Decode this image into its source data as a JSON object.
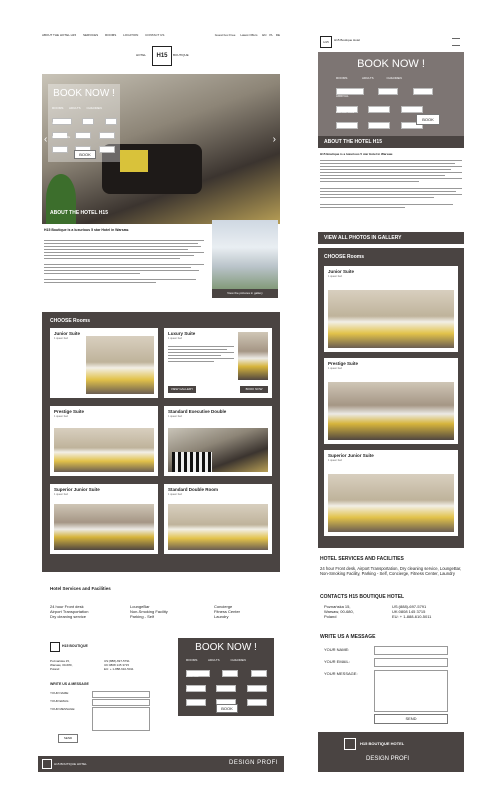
{
  "desktop": {
    "nav": [
      "ABOUT THE HOTEL H15",
      "SERVICES",
      "ROOMS",
      "LOCATION",
      "CONTACT US"
    ],
    "top_right": [
      "Guest box Free",
      "Latest Offers",
      "EN",
      "PL",
      "DE"
    ],
    "logo_left": "HOTEL",
    "logo": "H15",
    "logo_right": "BOUTIQUE",
    "booking": {
      "title": "BOOK NOW !",
      "rooms_label": "ROOMS",
      "adults_label": "ADULTS",
      "children_label": "CHILDREN",
      "arrival_label": "ARRIVAL",
      "departure_label": "DEPARTURE",
      "button": "BOOK"
    },
    "about_heading": "ABOUT THE HOTEL H15",
    "about_sub": "H15 Boutique is a luxurious 5 star Hotel in Warsaw.",
    "gallery_label": "View the pictures in gallery",
    "choose_heading": "CHOOSE Rooms",
    "rooms": [
      {
        "name": "Junior Suite",
        "sub": "1 queen bed"
      },
      {
        "name": "Luxury Suite",
        "sub": "1 queen bed"
      },
      {
        "name": "Prestige Suite",
        "sub": "1 queen bed"
      },
      {
        "name": "Standard Executive Double",
        "sub": "1 queen bed"
      },
      {
        "name": "Superior Junior Suite",
        "sub": "1 queen bed"
      },
      {
        "name": "Standard Double Room",
        "sub": "1 queen bed"
      }
    ],
    "view_gallery": "VIEW GALLERY",
    "book_now": "BOOK NOW",
    "services_heading": "Hotel Services and Facilities",
    "services_col1": [
      "24 hour Front desk",
      "Airport Transportation",
      "Dry cleaning service"
    ],
    "services_col2": [
      "LoungeBar",
      "Non-Smoking Facility",
      "Parking - Self"
    ],
    "services_col3": [
      "Concierge",
      "Fitness Center",
      "Laundry"
    ],
    "contact_heading": "H15 BOUTIQUE",
    "address": [
      "Poznańska 15,",
      "Warsaw, 00-680,",
      "Poland"
    ],
    "phones": [
      "US:(888)-697-5791",
      "UK:0808 145 3715",
      "EU: + 1-888-610-5011"
    ],
    "write_heading": "WRITE US A MESSAGE",
    "form": {
      "name": "YOUR NAME:",
      "email": "YOUR EMAIL:",
      "message": "YOUR MESSAGE:",
      "send": "SEND"
    },
    "footer_logo": "H15 BOUTIQUE HOTEL",
    "footer_brand": "DESIGN PROFI"
  },
  "mobile": {
    "logo": "H15",
    "logo_text": "H15 Boutique Hotel",
    "booking": {
      "title": "BOOK NOW !",
      "rooms_label": "ROOMS",
      "adults_label": "ADULTS",
      "children_label": "CHILDREN",
      "arrival_label": "ARRIVAL",
      "departure_label": "DEPARTURE",
      "button": "BOOK"
    },
    "about_heading": "ABOUT THE HOTEL H15",
    "about_sub": "H15 Boutique is a luxurious 5 star Hotel in Warsaw.",
    "view_all": "VIEW ALL PHOTOS IN GALLERY",
    "choose_heading": "CHOOSE Rooms",
    "rooms": [
      {
        "name": "Junior Suite",
        "sub": "1 queen bed"
      },
      {
        "name": "Prestige Suite",
        "sub": "1 queen bed"
      },
      {
        "name": "Superior Junior Suite",
        "sub": "1 queen bed"
      }
    ],
    "services_heading": "HOTEL SERVICES AND FACILITIES",
    "services_text": "24 hour Front desk, Airport Transportation, Dry cleaning service, LoungeBar, Non-Smoking Facility, Parking - Self, Concierge, Fitness Center, Laundry",
    "contacts_heading": "CONTACTS H15 BOUTIQUE HOTEL",
    "address": [
      "Poznańska 15,",
      "Warsaw, 00-680,",
      "Poland"
    ],
    "phones": [
      "US:(888)-697-5791",
      "UK:0808 145 3715",
      "EU: + 1-888-610-5011"
    ],
    "write_heading": "WRITE US A MESSAGE",
    "form": {
      "name": "YOUR NAME:",
      "email": "YOUR EMAIL:",
      "message": "YOUR MESSAGE:",
      "send": "SEND"
    },
    "footer_logo": "H15 BOUTIQUE HOTEL",
    "footer_brand": "DESIGN PROFI"
  }
}
